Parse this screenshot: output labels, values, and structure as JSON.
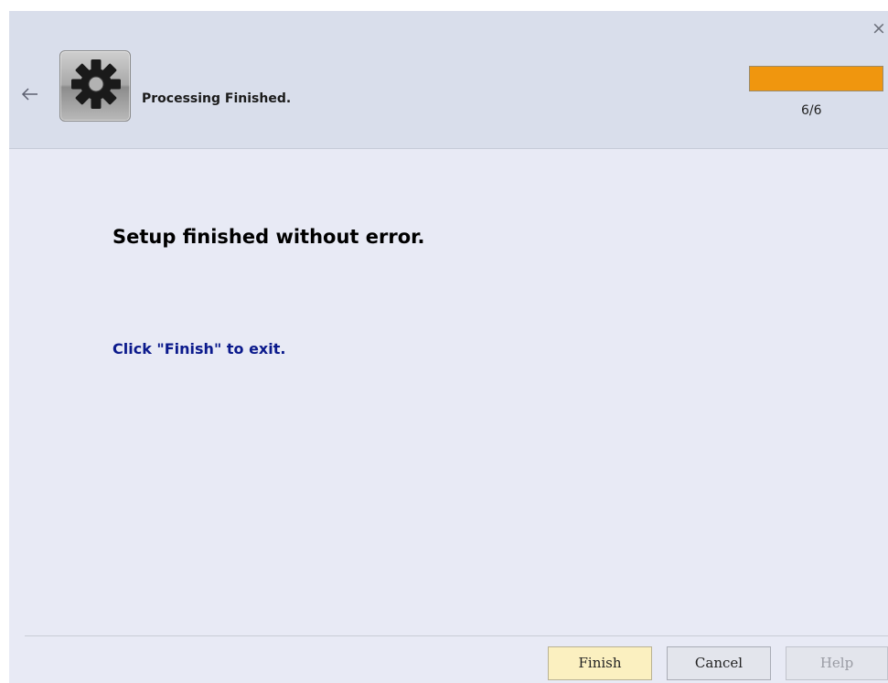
{
  "window": {
    "close_glyph": "×",
    "back_icon": "arrow-left-icon"
  },
  "header": {
    "icon": "gear-icon",
    "title": "Processing Finished.",
    "progress": {
      "current": 6,
      "total": 6,
      "fraction": 1.0,
      "text": "6/6",
      "color": "#f0960e"
    }
  },
  "main": {
    "heading": "Setup finished without error.",
    "instruction": "Click \"Finish\" to exit.",
    "instruction_color": "#0b1a8c"
  },
  "footer": {
    "finish_label": "Finish",
    "cancel_label": "Cancel",
    "help_label": "Help"
  }
}
